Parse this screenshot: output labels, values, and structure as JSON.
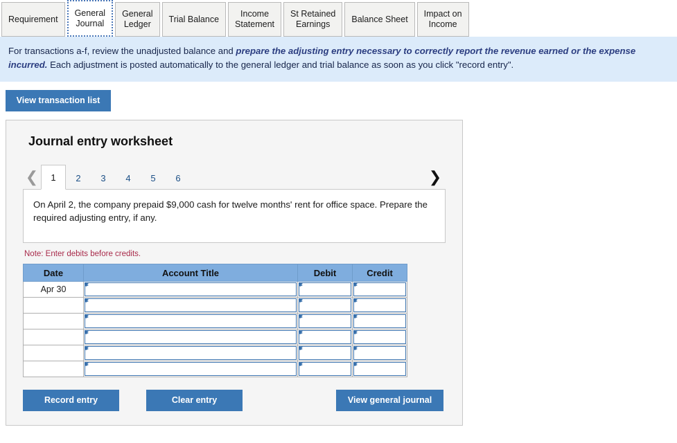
{
  "tabs": [
    {
      "label": "Requirement",
      "active": false
    },
    {
      "label": "General\nJournal",
      "active": true
    },
    {
      "label": "General\nLedger",
      "active": false
    },
    {
      "label": "Trial Balance",
      "active": false
    },
    {
      "label": "Income\nStatement",
      "active": false
    },
    {
      "label": "St Retained\nEarnings",
      "active": false
    },
    {
      "label": "Balance Sheet",
      "active": false
    },
    {
      "label": "Impact on\nIncome",
      "active": false
    }
  ],
  "banner": {
    "part1": "For transactions a-f, review the unadjusted balance and ",
    "emphasis": "prepare the adjusting entry necessary to correctly report the revenue earned or the expense incurred.",
    "part2": " Each adjustment is posted automatically to the general ledger and trial balance as soon as you click \"record entry\"."
  },
  "toolbar": {
    "view_transaction_list_label": "View transaction list"
  },
  "worksheet": {
    "title": "Journal entry worksheet",
    "pager": {
      "prev_icon": "chevron-left-icon",
      "next_icon": "chevron-right-icon",
      "prev_enabled": false,
      "next_enabled": true,
      "pages": [
        "1",
        "2",
        "3",
        "4",
        "5",
        "6"
      ],
      "active_page": "1"
    },
    "transaction_text": "On April 2, the company prepaid $9,000 cash for twelve months' rent for office space. Prepare the required adjusting entry, if any.",
    "note": "Note: Enter debits before credits.",
    "table": {
      "columns": [
        "Date",
        "Account Title",
        "Debit",
        "Credit"
      ],
      "rows": [
        {
          "date": "Apr 30",
          "account_title": "",
          "debit": "",
          "credit": ""
        },
        {
          "date": "",
          "account_title": "",
          "debit": "",
          "credit": ""
        },
        {
          "date": "",
          "account_title": "",
          "debit": "",
          "credit": ""
        },
        {
          "date": "",
          "account_title": "",
          "debit": "",
          "credit": ""
        },
        {
          "date": "",
          "account_title": "",
          "debit": "",
          "credit": ""
        },
        {
          "date": "",
          "account_title": "",
          "debit": "",
          "credit": ""
        }
      ]
    },
    "actions": {
      "record_entry_label": "Record entry",
      "clear_entry_label": "Clear entry",
      "view_general_journal_label": "View general journal"
    }
  },
  "colors": {
    "button_blue": "#3b78b5",
    "table_header_blue": "#7fadde",
    "banner_blue": "#dcebfa",
    "note_red": "#a82a4a",
    "panel_grey": "#f5f5f5",
    "active_tab_border": "#4a77b8"
  }
}
